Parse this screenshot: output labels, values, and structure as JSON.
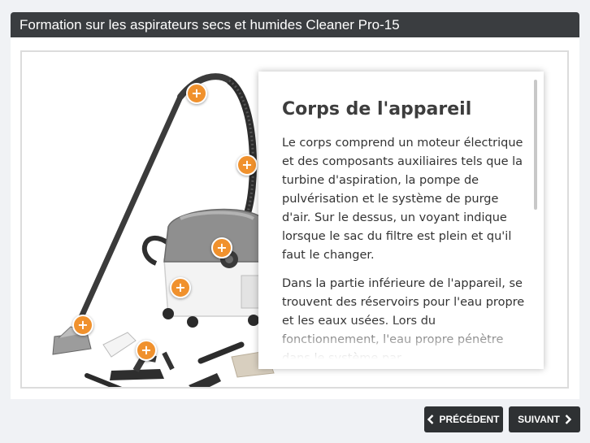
{
  "title": "Formation sur les aspirateurs secs et humides Cleaner Pro-15",
  "panel": {
    "heading": "Corps de l'appareil",
    "paragraphs": [
      "Le corps comprend un moteur électrique et des composants auxiliaires tels que la turbine d'aspiration, la pompe de pulvérisation et le système de purge d'air. Sur le dessus, un voyant indique lorsque le sac du filtre est plein et qu'il faut le changer.",
      "Dans la partie inférieure de l'appareil, se trouvent des réservoirs pour l'eau propre et les eaux usées. Lors du fonctionnement, l'eau propre pénètre dans le système par"
    ]
  },
  "hotspots": [
    "+",
    "+",
    "+",
    "+",
    "+",
    "+"
  ],
  "nav": {
    "prev_label": "PRÉCÉDENT",
    "next_label": "SUIVANT"
  },
  "colors": {
    "titlebar": "#3a3d40",
    "hotspot": "#f0912d",
    "button": "#2e3133"
  },
  "icons": {
    "prev": "chevron-left-icon",
    "next": "chevron-right-icon"
  }
}
